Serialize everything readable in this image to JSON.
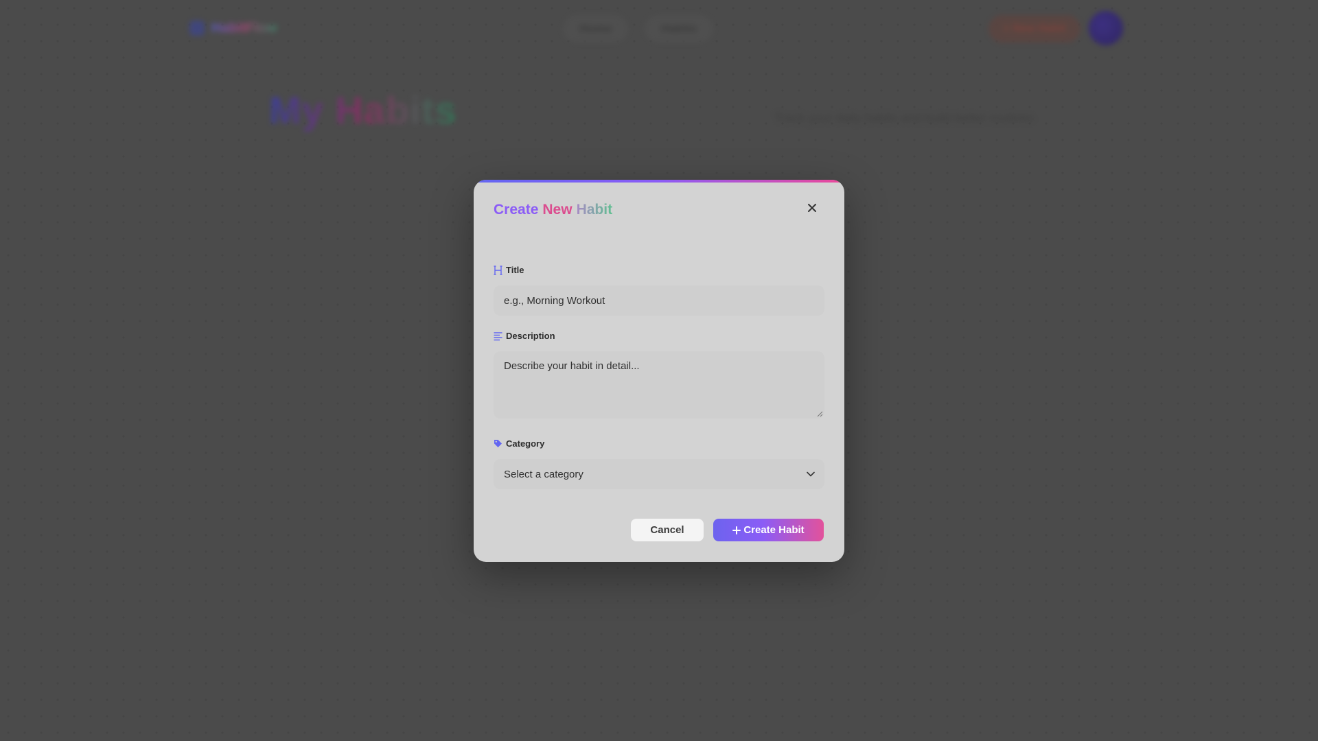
{
  "background": {
    "nav_logo_text": "HabitFlow",
    "nav_links": [
      "Home",
      "Habits"
    ],
    "nav_cta": "+ New Habit",
    "hero_title": "My Habits",
    "hero_subtitle": "Track your daily habits and build better routines"
  },
  "modal": {
    "title_parts": [
      "Create",
      "New",
      "Habit"
    ],
    "close_icon": "close-icon",
    "fields": {
      "title": {
        "label": "Title",
        "icon": "heading-icon",
        "placeholder": "e.g., Morning Workout"
      },
      "description": {
        "label": "Description",
        "icon": "text-lines-icon",
        "placeholder": "Describe your habit in detail..."
      },
      "category": {
        "label": "Category",
        "icon": "tag-icon",
        "selected": "Select a category"
      }
    },
    "buttons": {
      "cancel": "Cancel",
      "create": "Create Habit"
    }
  },
  "colors": {
    "accent_purple": "#8b5cf6",
    "accent_pink": "#ec4899",
    "accent_indigo": "#6366f1",
    "accent_green": "#5fbf90"
  }
}
